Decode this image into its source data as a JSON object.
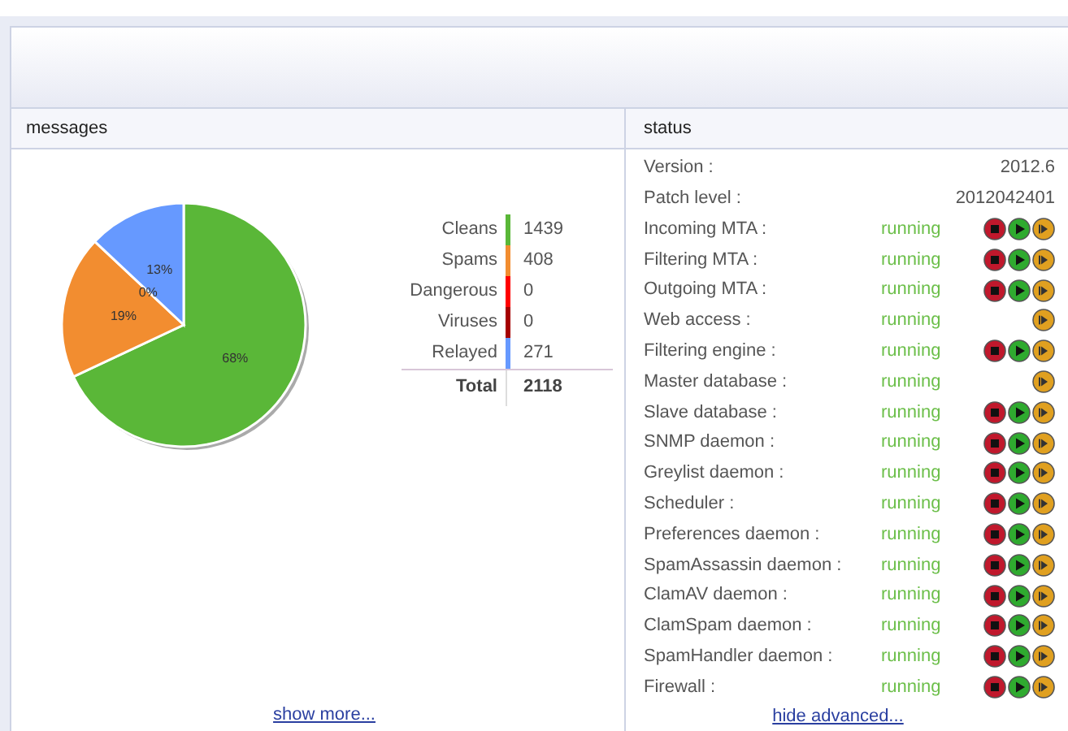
{
  "messages": {
    "title": "messages",
    "chart_data": {
      "type": "pie",
      "categories": [
        "Cleans",
        "Spams",
        "Dangerous",
        "Viruses",
        "Relayed"
      ],
      "values": [
        68,
        19,
        0,
        0,
        13
      ],
      "value_labels": [
        "68%",
        "19%",
        "0%",
        null,
        "13%"
      ]
    },
    "legend": [
      {
        "value": "1439",
        "color": "#5ab738"
      },
      {
        "value": "408",
        "color": "#f28d30"
      },
      {
        "value": "0",
        "color": "#ff0000"
      },
      {
        "value": "0",
        "color": "#a50000"
      },
      {
        "value": "271",
        "color": "#6699ff"
      }
    ],
    "total": {
      "label": "Total",
      "value": "2118"
    },
    "link": "show more..."
  },
  "status": {
    "title": "status",
    "rows": [
      {
        "kind": "info",
        "label": "Version :",
        "value": "2012.6"
      },
      {
        "kind": "info",
        "label": "Patch level :",
        "value": "2012042401"
      },
      {
        "kind": "service",
        "label": "Incoming MTA :",
        "state": "running",
        "stop": true,
        "start": true,
        "restart": true
      },
      {
        "kind": "service",
        "label": "Filtering MTA :",
        "state": "running",
        "stop": true,
        "start": true,
        "restart": true
      },
      {
        "kind": "service",
        "label": "Outgoing MTA :",
        "state": "running",
        "stop": true,
        "start": true,
        "restart": true
      },
      {
        "kind": "service",
        "label": "Web access :",
        "state": "running",
        "stop": false,
        "start": false,
        "restart": true
      },
      {
        "kind": "service",
        "label": "Filtering engine :",
        "state": "running",
        "stop": true,
        "start": true,
        "restart": true
      },
      {
        "kind": "service",
        "label": "Master database :",
        "state": "running",
        "stop": false,
        "start": false,
        "restart": true
      },
      {
        "kind": "service",
        "label": "Slave database :",
        "state": "running",
        "stop": true,
        "start": true,
        "restart": true
      },
      {
        "kind": "service",
        "label": "SNMP daemon :",
        "state": "running",
        "stop": true,
        "start": true,
        "restart": true
      },
      {
        "kind": "service",
        "label": "Greylist daemon :",
        "state": "running",
        "stop": true,
        "start": true,
        "restart": true
      },
      {
        "kind": "service",
        "label": "Scheduler :",
        "state": "running",
        "stop": true,
        "start": true,
        "restart": true
      },
      {
        "kind": "service",
        "label": "Preferences daemon :",
        "state": "running",
        "stop": true,
        "start": true,
        "restart": true
      },
      {
        "kind": "service",
        "label": "SpamAssassin daemon :",
        "state": "running",
        "stop": true,
        "start": true,
        "restart": true
      },
      {
        "kind": "service",
        "label": "ClamAV daemon :",
        "state": "running",
        "stop": true,
        "start": true,
        "restart": true
      },
      {
        "kind": "service",
        "label": "ClamSpam daemon :",
        "state": "running",
        "stop": true,
        "start": true,
        "restart": true
      },
      {
        "kind": "service",
        "label": "SpamHandler daemon :",
        "state": "running",
        "stop": true,
        "start": true,
        "restart": true
      },
      {
        "kind": "service",
        "label": "Firewall :",
        "state": "running",
        "stop": true,
        "start": true,
        "restart": true
      }
    ],
    "link": "hide advanced..."
  }
}
